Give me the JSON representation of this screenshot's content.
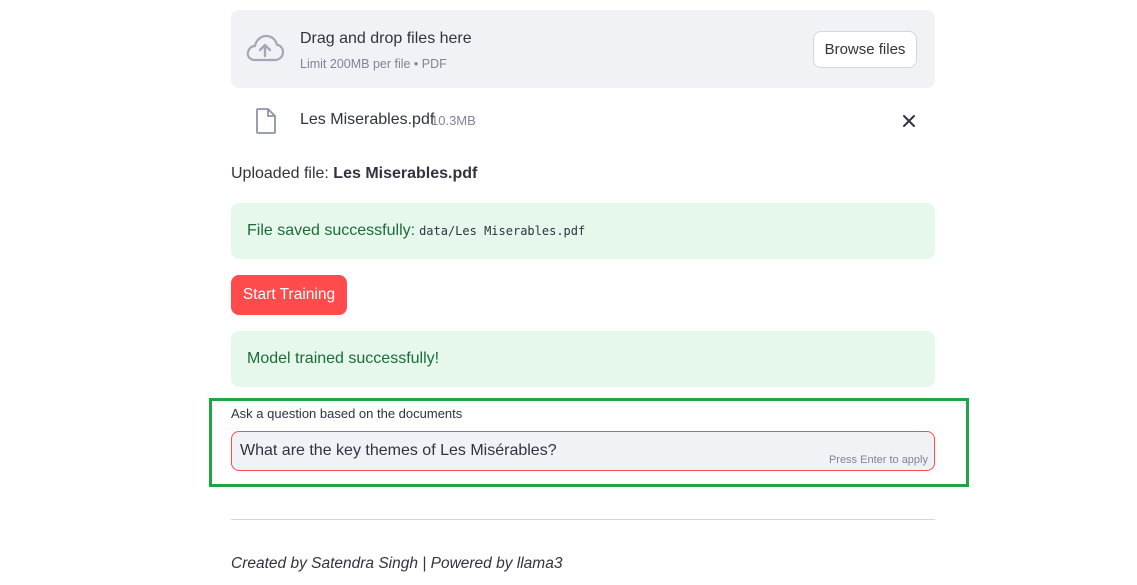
{
  "uploader": {
    "title": "Drag and drop files here",
    "limit": "Limit 200MB per file • PDF",
    "browse_label": "Browse files",
    "icon": "cloud-upload-icon"
  },
  "file": {
    "name": "Les Miserables.pdf",
    "size": "10.3MB",
    "icon": "file-icon",
    "remove_icon": "close-icon"
  },
  "uploaded": {
    "prefix": "Uploaded file: ",
    "name": "Les Miserables.pdf"
  },
  "alerts": {
    "saved_text": "File saved successfully:",
    "saved_path": "data/Les Miserables.pdf",
    "trained_text": "Model trained successfully!"
  },
  "train_button": "Start Training",
  "question": {
    "label": "Ask a question based on the documents",
    "value": "What are the key themes of Les Misérables?",
    "hint": "Press Enter to apply"
  },
  "footer": "Created by Satendra Singh | Powered by llama3",
  "colors": {
    "accent": "#ff4b4b",
    "success_bg": "#e6f8ec",
    "success_text": "#1e6b3a",
    "highlight": "#21a445"
  }
}
